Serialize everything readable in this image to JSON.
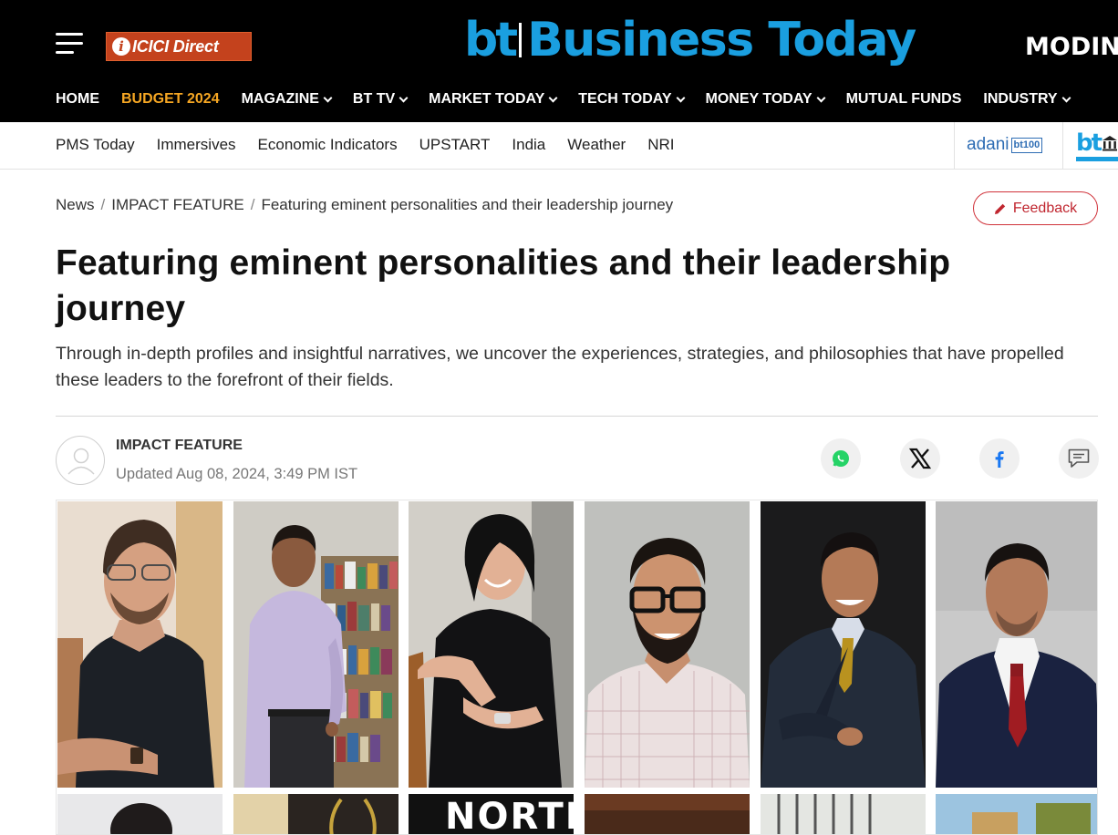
{
  "header": {
    "icici_label": "ICICI Direct",
    "brand_mark": "bt",
    "brand_name": "Business Today",
    "partner_label": "MODIN",
    "nav": [
      {
        "label": "HOME",
        "dropdown": false,
        "highlight": false
      },
      {
        "label": "BUDGET 2024",
        "dropdown": false,
        "highlight": true
      },
      {
        "label": "MAGAZINE",
        "dropdown": true,
        "highlight": false
      },
      {
        "label": "BT TV",
        "dropdown": true,
        "highlight": false
      },
      {
        "label": "MARKET TODAY",
        "dropdown": true,
        "highlight": false
      },
      {
        "label": "TECH TODAY",
        "dropdown": true,
        "highlight": false
      },
      {
        "label": "MONEY TODAY",
        "dropdown": true,
        "highlight": false
      },
      {
        "label": "MUTUAL FUNDS",
        "dropdown": false,
        "highlight": false
      },
      {
        "label": "INDUSTRY",
        "dropdown": true,
        "highlight": false
      }
    ],
    "highlight_color": "#f5a623",
    "brand_color": "#1a9fe0"
  },
  "subnav": {
    "items": [
      "PMS Today",
      "Immersives",
      "Economic Indicators",
      "UPSTART",
      "India",
      "Weather",
      "NRI"
    ],
    "adani_label": "adani",
    "bt100_label": "bt100",
    "bt_small_label": "bt"
  },
  "breadcrumb": {
    "items": [
      "News",
      "IMPACT FEATURE"
    ],
    "current": "Featuring eminent personalities and their leadership journey"
  },
  "feedback": {
    "label": "Feedback",
    "color": "#c0262f"
  },
  "article": {
    "headline": "Featuring eminent personalities and their leadership journey",
    "summary": "Through in-depth profiles and insightful narratives, we uncover the experiences, strategies, and philosophies that have propelled these leaders to the forefront of their fields.",
    "author": "IMPACT FEATURE",
    "updated": "Updated Aug 08, 2024, 3:49 PM IST"
  },
  "share": {
    "icons": [
      "whatsapp-icon",
      "x-icon",
      "facebook-icon",
      "comment-icon"
    ]
  },
  "collage": {
    "row2_text": "NORTE"
  }
}
